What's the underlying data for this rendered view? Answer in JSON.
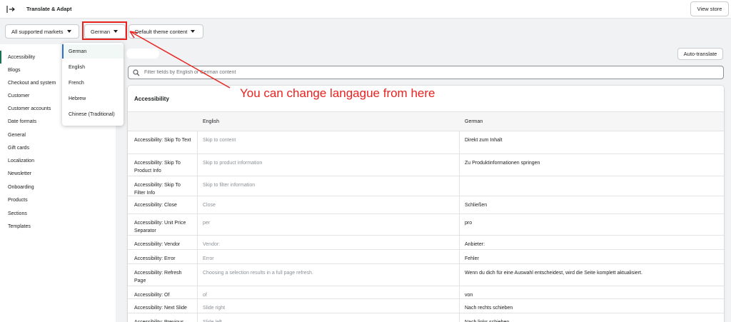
{
  "app": {
    "title": "Translate & Adapt",
    "view_store": "View store"
  },
  "filters": {
    "markets": "All supported markets",
    "language": "German",
    "content": "Default theme content"
  },
  "sidebar": {
    "items": [
      {
        "label": "Accessibility",
        "active": true
      },
      {
        "label": "Blogs"
      },
      {
        "label": "Checkout and system"
      },
      {
        "label": "Customer"
      },
      {
        "label": "Customer accounts"
      },
      {
        "label": "Date formats"
      },
      {
        "label": "General"
      },
      {
        "label": "Gift cards"
      },
      {
        "label": "Localization"
      },
      {
        "label": "Newsletter"
      },
      {
        "label": "Onboarding"
      },
      {
        "label": "Products"
      },
      {
        "label": "Sections"
      },
      {
        "label": "Templates"
      }
    ]
  },
  "language_dropdown": {
    "options": [
      "German",
      "English",
      "French",
      "Hebrew",
      "Chinese (Traditional)"
    ],
    "selected": "German"
  },
  "toolbar": {
    "auto_translate": "Auto-translate"
  },
  "search": {
    "placeholder": "Filter fields by English or German content",
    "value": ""
  },
  "card": {
    "title": "Accessibility",
    "columns": [
      "English",
      "German"
    ],
    "rows": [
      {
        "key": "Accessibility: Skip To Text",
        "english": "Skip to content",
        "german": "Direkt zum Inhalt"
      },
      {
        "key": "Accessibility: Skip To Product Info",
        "english": "Skip to product information",
        "german": "Zu Produktinformationen springen"
      },
      {
        "key": "Accessibility: Skip To Filter Info",
        "english": "Skip to filter information",
        "german": ""
      },
      {
        "key": "Accessibility: Close",
        "english": "Close",
        "german": "Schließen"
      },
      {
        "key": "Accessibility: Unit Price Separator",
        "english": "per",
        "german": "pro"
      },
      {
        "key": "Accessibility: Vendor",
        "english": "Vendor:",
        "german": "Anbieter:"
      },
      {
        "key": "Accessibility: Error",
        "english": "Error",
        "german": "Fehler"
      },
      {
        "key": "Accessibility: Refresh Page",
        "english": "Choosing a selection results in a full page refresh.",
        "german": "Wenn du dich für eine Auswahl entscheidest, wird die Seite komplett aktualisiert."
      },
      {
        "key": "Accessibility: Of",
        "english": "of",
        "german": "von"
      },
      {
        "key": "Accessibility: Next Slide",
        "english": "Slide right",
        "german": "Nach rechts schieben"
      },
      {
        "key": "Accessibility: Previous",
        "english": "Slide left",
        "german": "Nach links schieben"
      }
    ]
  },
  "annotation": {
    "text": "You can change langague from here",
    "color": "#e8231f"
  }
}
